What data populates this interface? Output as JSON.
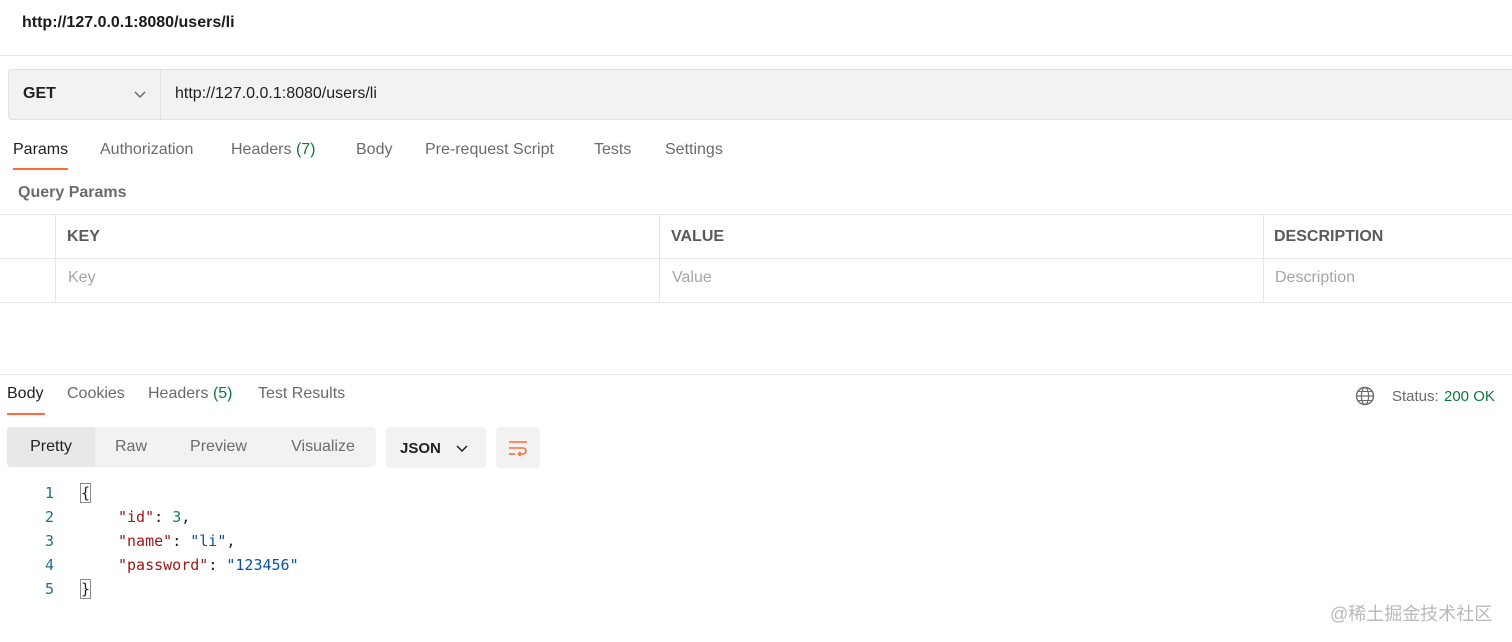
{
  "request": {
    "title": "http://127.0.0.1:8080/users/li",
    "method": "GET",
    "url": "http://127.0.0.1:8080/users/li"
  },
  "request_tabs": [
    {
      "label": "Params",
      "count": ""
    },
    {
      "label": "Authorization",
      "count": ""
    },
    {
      "label": "Headers",
      "count": "(7)"
    },
    {
      "label": "Body",
      "count": ""
    },
    {
      "label": "Pre-request Script",
      "count": ""
    },
    {
      "label": "Tests",
      "count": ""
    },
    {
      "label": "Settings",
      "count": ""
    }
  ],
  "query_params": {
    "label": "Query Params",
    "columns": [
      "KEY",
      "VALUE",
      "DESCRIPTION"
    ],
    "placeholders": [
      "Key",
      "Value",
      "Description"
    ]
  },
  "response_tabs": [
    {
      "label": "Body",
      "count": ""
    },
    {
      "label": "Cookies",
      "count": ""
    },
    {
      "label": "Headers",
      "count": "(5)"
    },
    {
      "label": "Test Results",
      "count": ""
    }
  ],
  "status": {
    "label": "Status:",
    "value": "200 OK"
  },
  "view_modes": [
    "Pretty",
    "Raw",
    "Preview",
    "Visualize"
  ],
  "format": "JSON",
  "code": {
    "line_numbers": [
      "1",
      "2",
      "3",
      "4",
      "5"
    ],
    "open_brace": "{",
    "close_brace": "}",
    "fields": [
      {
        "key": "\"id\"",
        "value": "3",
        "trail": ","
      },
      {
        "key": "\"name\"",
        "value": "\"li\"",
        "trail": ","
      },
      {
        "key": "\"password\"",
        "value": "\"123456\"",
        "trail": ""
      }
    ]
  },
  "watermark": "@稀土掘金技术社区",
  "colors": {
    "accent": "#ff6c37",
    "success": "#0b7a3b"
  },
  "icons": [
    "chevron-down-icon",
    "globe-icon",
    "wrap-lines-icon"
  ]
}
